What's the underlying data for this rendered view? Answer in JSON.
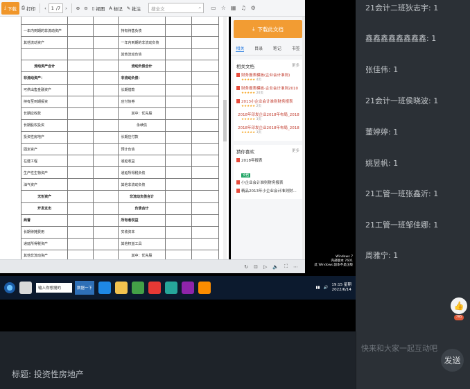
{
  "toolbar": {
    "download_label": "下载",
    "print_label": "打印",
    "page_current": "1",
    "page_total": "/7",
    "view_label": "视图",
    "mark_label": "标记",
    "annotate_label": "批注",
    "search_placeholder": "搜全文"
  },
  "document": {
    "rows": [
      [
        "",
        "",
        "",
        "",
        "",
        ""
      ],
      [
        "一年内到期的非流动资产",
        "",
        "",
        "持有待售负债",
        "",
        ""
      ],
      [
        "其他流动资产",
        "",
        "",
        "一年内到期的非流动负债",
        "",
        ""
      ],
      [
        "",
        "",
        "",
        "其他流动负债",
        "",
        ""
      ],
      [
        "流动资产合计",
        "",
        "",
        "流动负债合计",
        "",
        ""
      ],
      [
        "非流动资产：",
        "",
        "",
        "非流动负债：",
        "",
        ""
      ],
      [
        "可供出售金融资产",
        "",
        "",
        "长期借款",
        "",
        ""
      ],
      [
        "持有至到期投资",
        "",
        "",
        "应付债券",
        "",
        ""
      ],
      [
        "长期应收款",
        "",
        "",
        "其中：优先股",
        "",
        ""
      ],
      [
        "长期股权投资",
        "",
        "",
        "永续债",
        "",
        ""
      ],
      [
        "投资性房地产",
        "",
        "",
        "长期应付款",
        "",
        ""
      ],
      [
        "固定资产",
        "",
        "",
        "预计负债",
        "",
        ""
      ],
      [
        "在建工程",
        "",
        "",
        "递延收益",
        "",
        ""
      ],
      [
        "生产性生物资产",
        "",
        "",
        "递延所得税负债",
        "",
        ""
      ],
      [
        "油气资产",
        "",
        "",
        "其他非流动负债",
        "",
        ""
      ],
      [
        "无形资产",
        "",
        "",
        "非流动负债合计",
        "",
        ""
      ],
      [
        "开发支出",
        "",
        "",
        "负债合计",
        "",
        ""
      ],
      [
        "商誉",
        "",
        "",
        "所有者权益",
        "",
        ""
      ],
      [
        "长期待摊费用",
        "",
        "",
        "实收资本",
        "",
        ""
      ],
      [
        "递延所得税资产",
        "",
        "",
        "其他权益工具",
        "",
        ""
      ],
      [
        "其他非流动资产",
        "",
        "",
        "其中：优先股",
        "",
        ""
      ]
    ]
  },
  "sidebar": {
    "download_doc": "下载此文档",
    "tabs": [
      "相关",
      "目录",
      "笔记",
      "书签"
    ],
    "related_title": "相关文档",
    "more": "更多",
    "related": [
      {
        "title": "财务报表模板(企业会计准则)",
        "pages": "4页"
      },
      {
        "title": "财务报表模板-企业会计准则2010",
        "pages": "20页"
      },
      {
        "title": "2013小企业会计准则财务报表",
        "pages": "2页"
      },
      {
        "title": "2018年印发企业2018年布局_2018...",
        "pages": "3页"
      },
      {
        "title": "2018年印发企业2018年布局_2018...",
        "pages": "3页"
      }
    ],
    "recommend_title": "猜你喜欢",
    "recommend": [
      {
        "title": "2018年报表"
      },
      {
        "title": "小企业会计准则财务报表"
      },
      {
        "title": "精品2013年小企业会计准则财..."
      }
    ],
    "rec_badge": "文档"
  },
  "windows": {
    "watermark_lines": [
      "Windows 7",
      "内部版本 7601",
      "此 Windows 副本不是正版"
    ],
    "taskbar_input": "输入你想搜的",
    "taskbar_doc": "数据一下",
    "clock_time": "19:15 星期",
    "clock_date": "2022/6/14"
  },
  "chat": {
    "messages": [
      {
        "text": "21会计二班狄志宇: 1"
      },
      {
        "text": "鑫鑫鑫鑫鑫鑫鑫鑫: 1"
      },
      {
        "text": "张佳伟: 1"
      },
      {
        "text": "21会计一班侯晓波: 1"
      },
      {
        "text": "董婷婷: 1"
      },
      {
        "text": "姚昱帆: 1"
      },
      {
        "text": "21工管一班张鑫沂: 1"
      },
      {
        "text": "21工管一班邹佳娜: 1"
      },
      {
        "text": "周雅宁: 1"
      }
    ],
    "like_count": "795",
    "input_placeholder": "快来和大家一起互动吧",
    "send_label": "发送"
  },
  "footer": {
    "title": "标题: 投资性房地产"
  }
}
